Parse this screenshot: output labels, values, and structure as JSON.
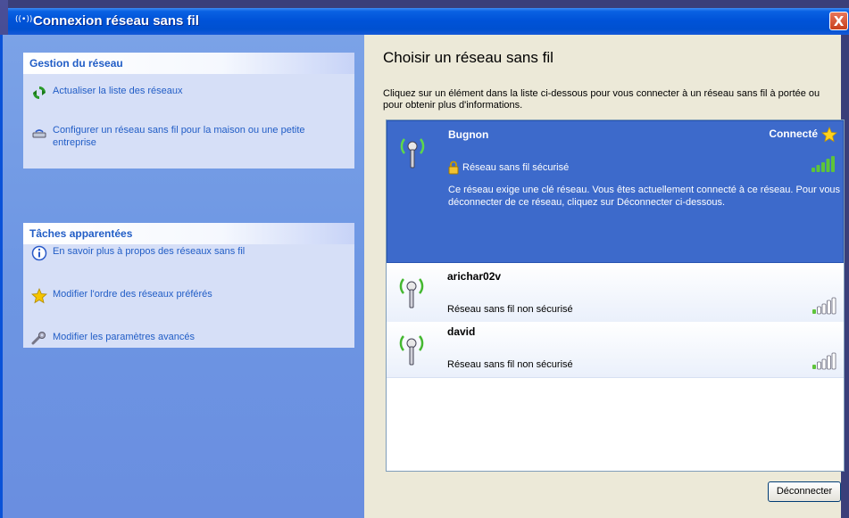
{
  "window": {
    "title": "Connexion réseau sans fil",
    "close_label": "X"
  },
  "sidebar": {
    "network_tasks": {
      "title": "Gestion du réseau",
      "items": [
        {
          "label": "Actualiser la liste des réseaux",
          "icon": "refresh-icon"
        },
        {
          "label": "Configurer un réseau sans fil pour la maison ou une petite entreprise",
          "icon": "wizard-icon"
        }
      ]
    },
    "related_tasks": {
      "title": "Tâches apparentées",
      "items": [
        {
          "label": "En savoir plus à propos des réseaux sans fil",
          "icon": "info-icon"
        },
        {
          "label": "Modifier l'ordre des réseaux préférés",
          "icon": "star-icon"
        },
        {
          "label": "Modifier les paramètres avancés",
          "icon": "settings-icon"
        }
      ]
    }
  },
  "main": {
    "heading": "Choisir un réseau sans fil",
    "instructions": "Cliquez sur un élément dans la liste ci-dessous pour vous connecter à un réseau sans fil à portée ou pour obtenir plus d'informations.",
    "networks": [
      {
        "name": "Bugnon",
        "status": "Connecté",
        "security": "Réseau sans fil sécurisé",
        "description": "Ce réseau exige une clé réseau. Vous êtes actuellement connecté à ce réseau. Pour vous déconnecter de ce réseau, cliquez sur Déconnecter ci-dessous.",
        "signal_bars": 5,
        "selected": true
      },
      {
        "name": "arichar02v",
        "security": "Réseau sans fil non sécurisé",
        "signal_bars": 1
      },
      {
        "name": "david",
        "security": "Réseau sans fil non sécurisé",
        "signal_bars": 1
      }
    ],
    "disconnect_label": "Déconnecter"
  },
  "colors": {
    "titlebar": "#0053d8",
    "sidebar_link": "#215dc6",
    "selected_row": "#3d6acb",
    "signal_active": "#5ec43a"
  }
}
